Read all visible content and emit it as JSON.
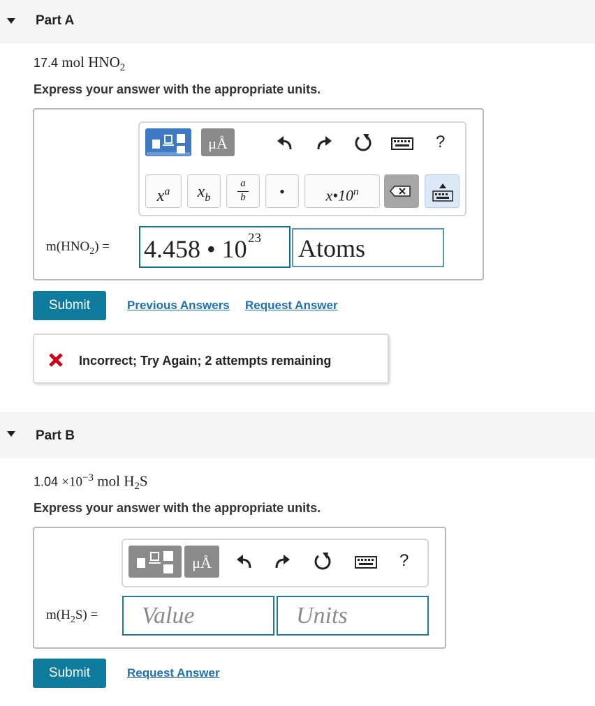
{
  "partA": {
    "title": "Part A",
    "question_qty": "17.4",
    "question_unit": "mol HNO",
    "question_sub": "2",
    "prompt": "Express your answer with the appropriate units.",
    "toolbar": {
      "mu_label": "μÅ",
      "undo_icon": "undo-icon",
      "redo_icon": "redo-icon",
      "reset_icon": "reset-icon",
      "keyboard_icon": "keyboard-icon",
      "help_label": "?",
      "sup_base": "x",
      "sup_exp": "a",
      "sub_base": "x",
      "sub_idx": "b",
      "frac_num": "a",
      "frac_den": "b",
      "dot_label": "•",
      "sci_label": "x•10",
      "sci_exp": "n"
    },
    "label_m": "m(HNO",
    "label_sub": "2",
    "label_close": ") =",
    "value_mantissa": "4.458 • 10",
    "value_exp": "23",
    "units_value": "Atoms",
    "submit_label": "Submit",
    "previous_answers_label": "Previous Answers",
    "request_answer_label": "Request Answer",
    "feedback_text": "Incorrect; Try Again; 2 attempts remaining",
    "feedback_color": "#d0021b"
  },
  "partB": {
    "title": "Part B",
    "question_qty": "1.04",
    "question_times": "×10",
    "question_exp": "−3",
    "question_unit": "mol H",
    "question_sub": "2",
    "question_tail": "S",
    "prompt": "Express your answer with the appropriate units.",
    "toolbar": {
      "mu_label": "μÅ",
      "help_label": "?"
    },
    "label_m": "m(H",
    "label_sub": "2",
    "label_close": "S) =",
    "value_placeholder": "Value",
    "units_placeholder": "Units",
    "submit_label": "Submit",
    "request_answer_label": "Request Answer"
  },
  "colors": {
    "accent": "#0f7c9e",
    "link": "#1f6fb3",
    "tpl_blue": "#3e79c6"
  }
}
